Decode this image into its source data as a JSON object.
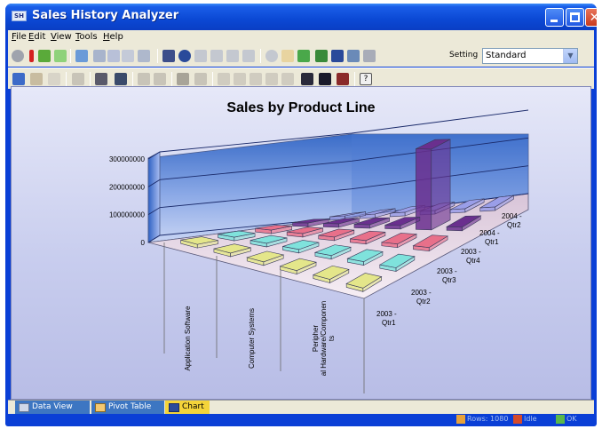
{
  "window": {
    "title": "Sales History Analyzer"
  },
  "menu": [
    "File",
    "Edit",
    "View",
    "Tools",
    "Help"
  ],
  "toolbar": {
    "setting_label": "Setting",
    "setting_value": "Standard"
  },
  "chart_data": {
    "type": "bar",
    "title": "Sales by Product Line",
    "subtype": "3d-column",
    "categories": [
      "2003 - Qtr1",
      "2003 - Qtr2",
      "2003 - Qtr3",
      "2003 - Qtr4",
      "2004 - Qtr1",
      "2004 - Qtr2"
    ],
    "series": [
      {
        "name": "Application Software",
        "values": [
          0,
          0,
          0,
          0,
          0,
          0
        ]
      },
      {
        "name": "Computer Systems",
        "values": [
          0,
          0,
          0,
          0,
          0,
          0
        ]
      },
      {
        "name": "Peripheral Hardware/Components",
        "values": [
          0,
          0,
          0,
          0,
          0,
          0
        ]
      },
      {
        "name": "",
        "values": [
          0,
          0,
          0,
          0,
          290000000,
          0
        ]
      },
      {
        "name": "",
        "values": [
          0,
          0,
          0,
          0,
          0,
          0
        ]
      }
    ],
    "y_ticks": [
      "0",
      "100000000",
      "200000000",
      "300000000"
    ],
    "ylim": [
      0,
      300000000
    ],
    "series_colors": [
      "#e4e68a",
      "#7fe2dc",
      "#e8708a",
      "#6a2f8e",
      "#9a9ee8"
    ],
    "grid": true
  },
  "tabs": [
    {
      "label": "Data View"
    },
    {
      "label": "Pivot Table"
    },
    {
      "label": "Chart"
    }
  ],
  "status": [
    {
      "label": "Rows: 1080"
    },
    {
      "label": "Idle"
    },
    {
      "label": "OK"
    }
  ]
}
